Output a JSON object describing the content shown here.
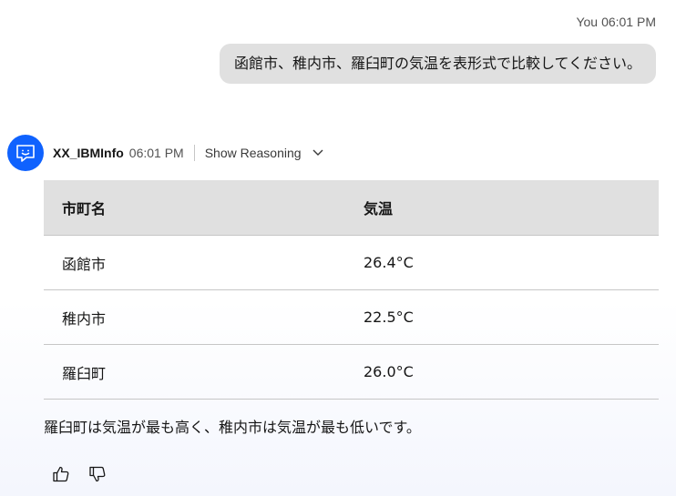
{
  "user_message": {
    "sender": "You",
    "time": "06:01 PM",
    "text": "函館市、稚内市、羅臼町の気温を表形式で比較してください。"
  },
  "bot_message": {
    "name": "XX_IBMInfo",
    "time": "06:01 PM",
    "reasoning_label": "Show Reasoning",
    "table": {
      "headers": [
        "市町名",
        "気温"
      ],
      "rows": [
        [
          "函館市",
          "26.4°C"
        ],
        [
          "稚内市",
          "22.5°C"
        ],
        [
          "羅臼町",
          "26.0°C"
        ]
      ]
    },
    "summary": "羅臼町は気温が最も高く、稚内市は気温が最も低いです。"
  },
  "icons": {
    "avatar": "chatbot-icon",
    "reasoning_toggle": "chevron-down-icon",
    "like": "thumbs-up-icon",
    "dislike": "thumbs-down-icon"
  },
  "colors": {
    "avatar_bg": "#0f62fe",
    "user_bubble_bg": "#e0e0e0",
    "table_header_bg": "#e0e0e0"
  }
}
